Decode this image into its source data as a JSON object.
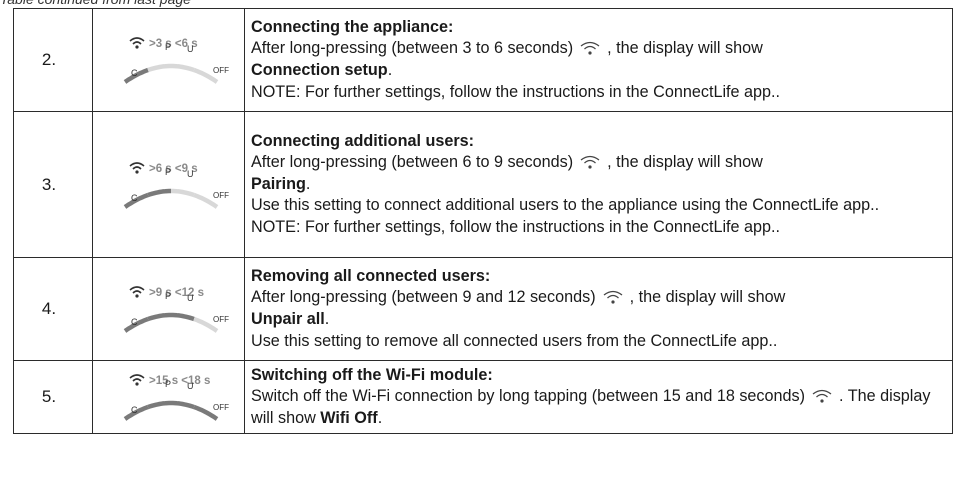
{
  "header": {
    "text": "Table continued from last page"
  },
  "rows": [
    {
      "number": "2.",
      "dial": {
        "range_min": ">3 s",
        "range_max": "<6 s",
        "labels": [
          "C",
          "P",
          "U",
          "OFF"
        ],
        "active_segments": 1
      },
      "title": "Connecting the appliance:",
      "p1_a": "After long-pressing (between 3 to 6 seconds)",
      "p1_b": ", the display will show",
      "p1_bold": "Connection setup",
      "p1_end": ".",
      "note": "NOTE: For further settings, follow the instructions in the ConnectLife app.."
    },
    {
      "number": "3.",
      "dial": {
        "range_min": ">6 s",
        "range_max": "<9 s",
        "labels": [
          "C",
          "P",
          "U",
          "OFF"
        ],
        "active_segments": 2
      },
      "title": "Connecting additional users:",
      "p1_a": "After long-pressing (between 6 to 9 seconds)",
      "p1_b": ", the display will show",
      "p1_bold": "Pairing",
      "p1_end": ".",
      "p2": "Use this setting to connect additional users to the appliance using the ConnectLife app..",
      "note": "NOTE: For further settings, follow the instructions in the ConnectLife app.."
    },
    {
      "number": "4.",
      "dial": {
        "range_min": ">9 s",
        "range_max": "<12 s",
        "labels": [
          "C",
          "P",
          "U",
          "OFF"
        ],
        "active_segments": 3
      },
      "title": "Removing all connected users:",
      "p1_a": "After long-pressing (between 9 and 12 seconds)",
      "p1_b": ", the display will show",
      "p1_bold": "Unpair all",
      "p1_end": ".",
      "p2": "Use this setting to remove all connected users from the ConnectLife app.."
    },
    {
      "number": "5.",
      "dial": {
        "range_min": ">15 s",
        "range_max": "<18 s",
        "labels": [
          "C",
          "P",
          "U",
          "OFF"
        ],
        "active_segments": 4
      },
      "title": "Switching off the Wi-Fi module:",
      "p1_a": "Switch off the Wi-Fi connection by long tapping (between 15 and 18 seconds)",
      "p1_b": ". The display will show",
      "p1_bold": "Wifi Off",
      "p1_end": "."
    }
  ],
  "colors": {
    "active": "#7a7a7a",
    "inactive": "#d8d8d8",
    "icon_text": "#8a8a8a"
  }
}
